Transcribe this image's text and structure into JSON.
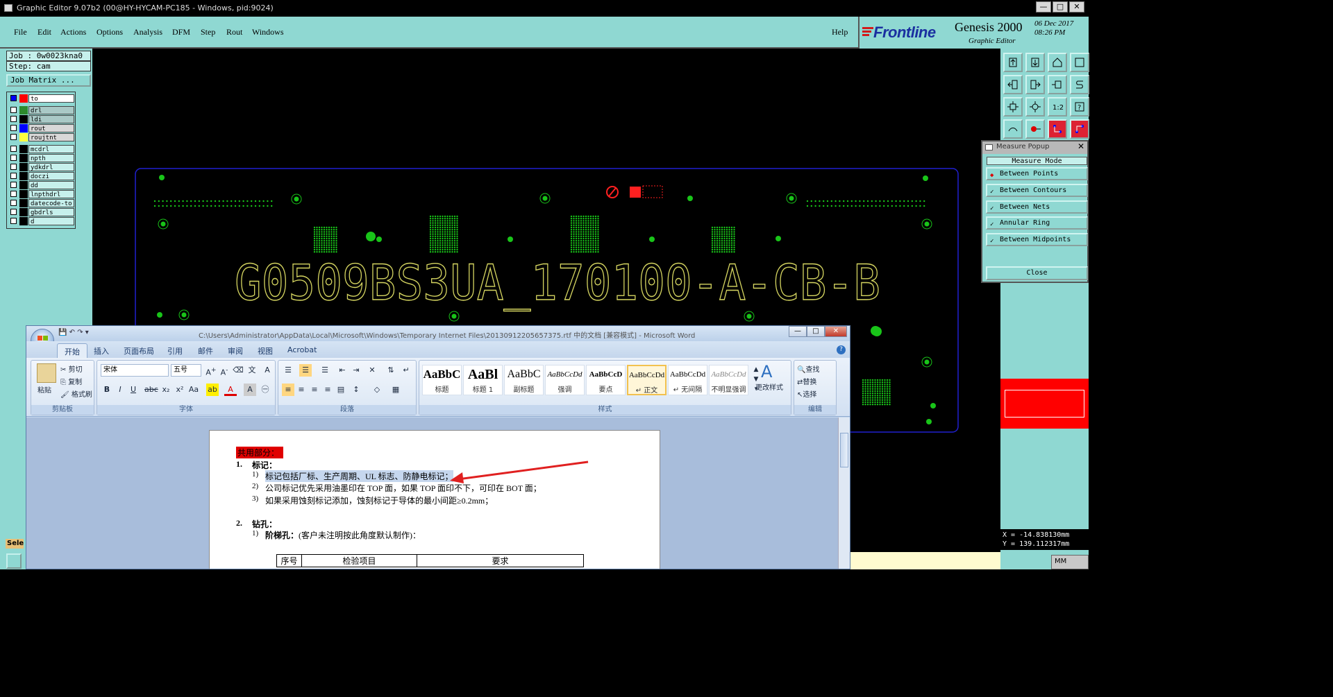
{
  "genesis": {
    "window_title": "Graphic Editor 9.07b2 (00@HY-HYCAM-PC185 - Windows, pid:9024)",
    "menu": [
      "File",
      "Edit",
      "Actions",
      "Options",
      "Analysis",
      "DFM",
      "Step",
      "Rout",
      "Windows"
    ],
    "help": "Help",
    "brand": "Frontline",
    "product": "Genesis 2000",
    "product_sub": "Graphic Editor",
    "date": "06 Dec 2017\n08:26 PM",
    "job_label": "Job : 0w0023kna0",
    "step_label": "Step: cam",
    "job_matrix": "Job Matrix ...",
    "layers_top": [
      {
        "name": "to",
        "color": "#ff0000",
        "mark": "#0000ff"
      },
      {
        "name": "drl",
        "color": "#2d8a2d"
      },
      {
        "name": "ldi",
        "color": "#000000"
      },
      {
        "name": "rout",
        "color": "#0000ff"
      },
      {
        "name": "roujtnt",
        "color": "#ffff40"
      }
    ],
    "layers_bottom": [
      "mcdrl",
      "npth",
      "ydkdrl",
      "doczi",
      "dd",
      "lnpthdrl",
      "datecode-to",
      "gbdrls",
      "d"
    ],
    "select_label": "Sele",
    "board_text": "G0509BS3UA_170100-A-CB-B",
    "coords": "X = -14.838130mm\nY = 139.112317mm",
    "units": "MM"
  },
  "measure_popup": {
    "title": "Measure Popup",
    "header": "Measure Mode",
    "options": [
      {
        "label": "Between Points",
        "active": true
      },
      {
        "label": "Between Contours",
        "active": false
      },
      {
        "label": "Between Nets",
        "active": false
      },
      {
        "label": "Annular Ring",
        "active": false
      },
      {
        "label": "Between Midpoints",
        "active": false
      }
    ],
    "close": "Close"
  },
  "word": {
    "title": "C:\\Users\\Administrator\\AppData\\Local\\Microsoft\\Windows\\Temporary Internet Files\\20130912205657375.rtf 中的文档 [兼容模式] - Microsoft Word",
    "tabs": [
      "开始",
      "插入",
      "页面布局",
      "引用",
      "邮件",
      "审阅",
      "视图",
      "Acrobat"
    ],
    "clipboard": {
      "paste": "粘贴",
      "cut": "剪切",
      "copy": "复制",
      "format_painter": "格式刷",
      "label": "剪贴板"
    },
    "font": {
      "name": "宋体",
      "size": "五号",
      "label": "字体"
    },
    "paragraph": {
      "label": "段落"
    },
    "styles": {
      "tiles": [
        {
          "preview": "AaBbC",
          "name": "标题"
        },
        {
          "preview": "AaBl",
          "name": "标题 1"
        },
        {
          "preview": "AaBbC",
          "name": "副标题"
        },
        {
          "preview": "AaBbCcDd",
          "name": "强调"
        },
        {
          "preview": "AaBbCcD",
          "name": "要点"
        },
        {
          "preview": "AaBbCcDd",
          "name": "↵ 正文"
        },
        {
          "preview": "AaBbCcDd",
          "name": "↵ 无间隔"
        },
        {
          "preview": "AaBbCcDd",
          "name": "不明显强调"
        }
      ],
      "change": "更改样式",
      "label": "样式"
    },
    "editing": {
      "find": "查找",
      "replace": "替换",
      "select": "选择",
      "label": "编辑"
    },
    "doc": {
      "heading": "共用部分：",
      "s1_num": "1.",
      "s1": "标记：",
      "l1_num": "1)",
      "l1": "标记包括厂标、生产周期、UL 标志、防静电标记；",
      "l2_num": "2)",
      "l2": "公司标记优先采用油墨印在 TOP 面，如果 TOP 面印不下，可印在 BOT 面；",
      "l3_num": "3)",
      "l3": "如果采用蚀刻标记添加，蚀刻标记于导体的最小间距≥0.2mm；",
      "s2_num": "2.",
      "s2": "钻孔：",
      "l4_num": "1)",
      "l4_bold": "阶梯孔：",
      "l4": "(客户未注明按此角度默认制作)：",
      "table_headers": [
        "序号",
        "检验项目",
        "要求"
      ]
    }
  }
}
